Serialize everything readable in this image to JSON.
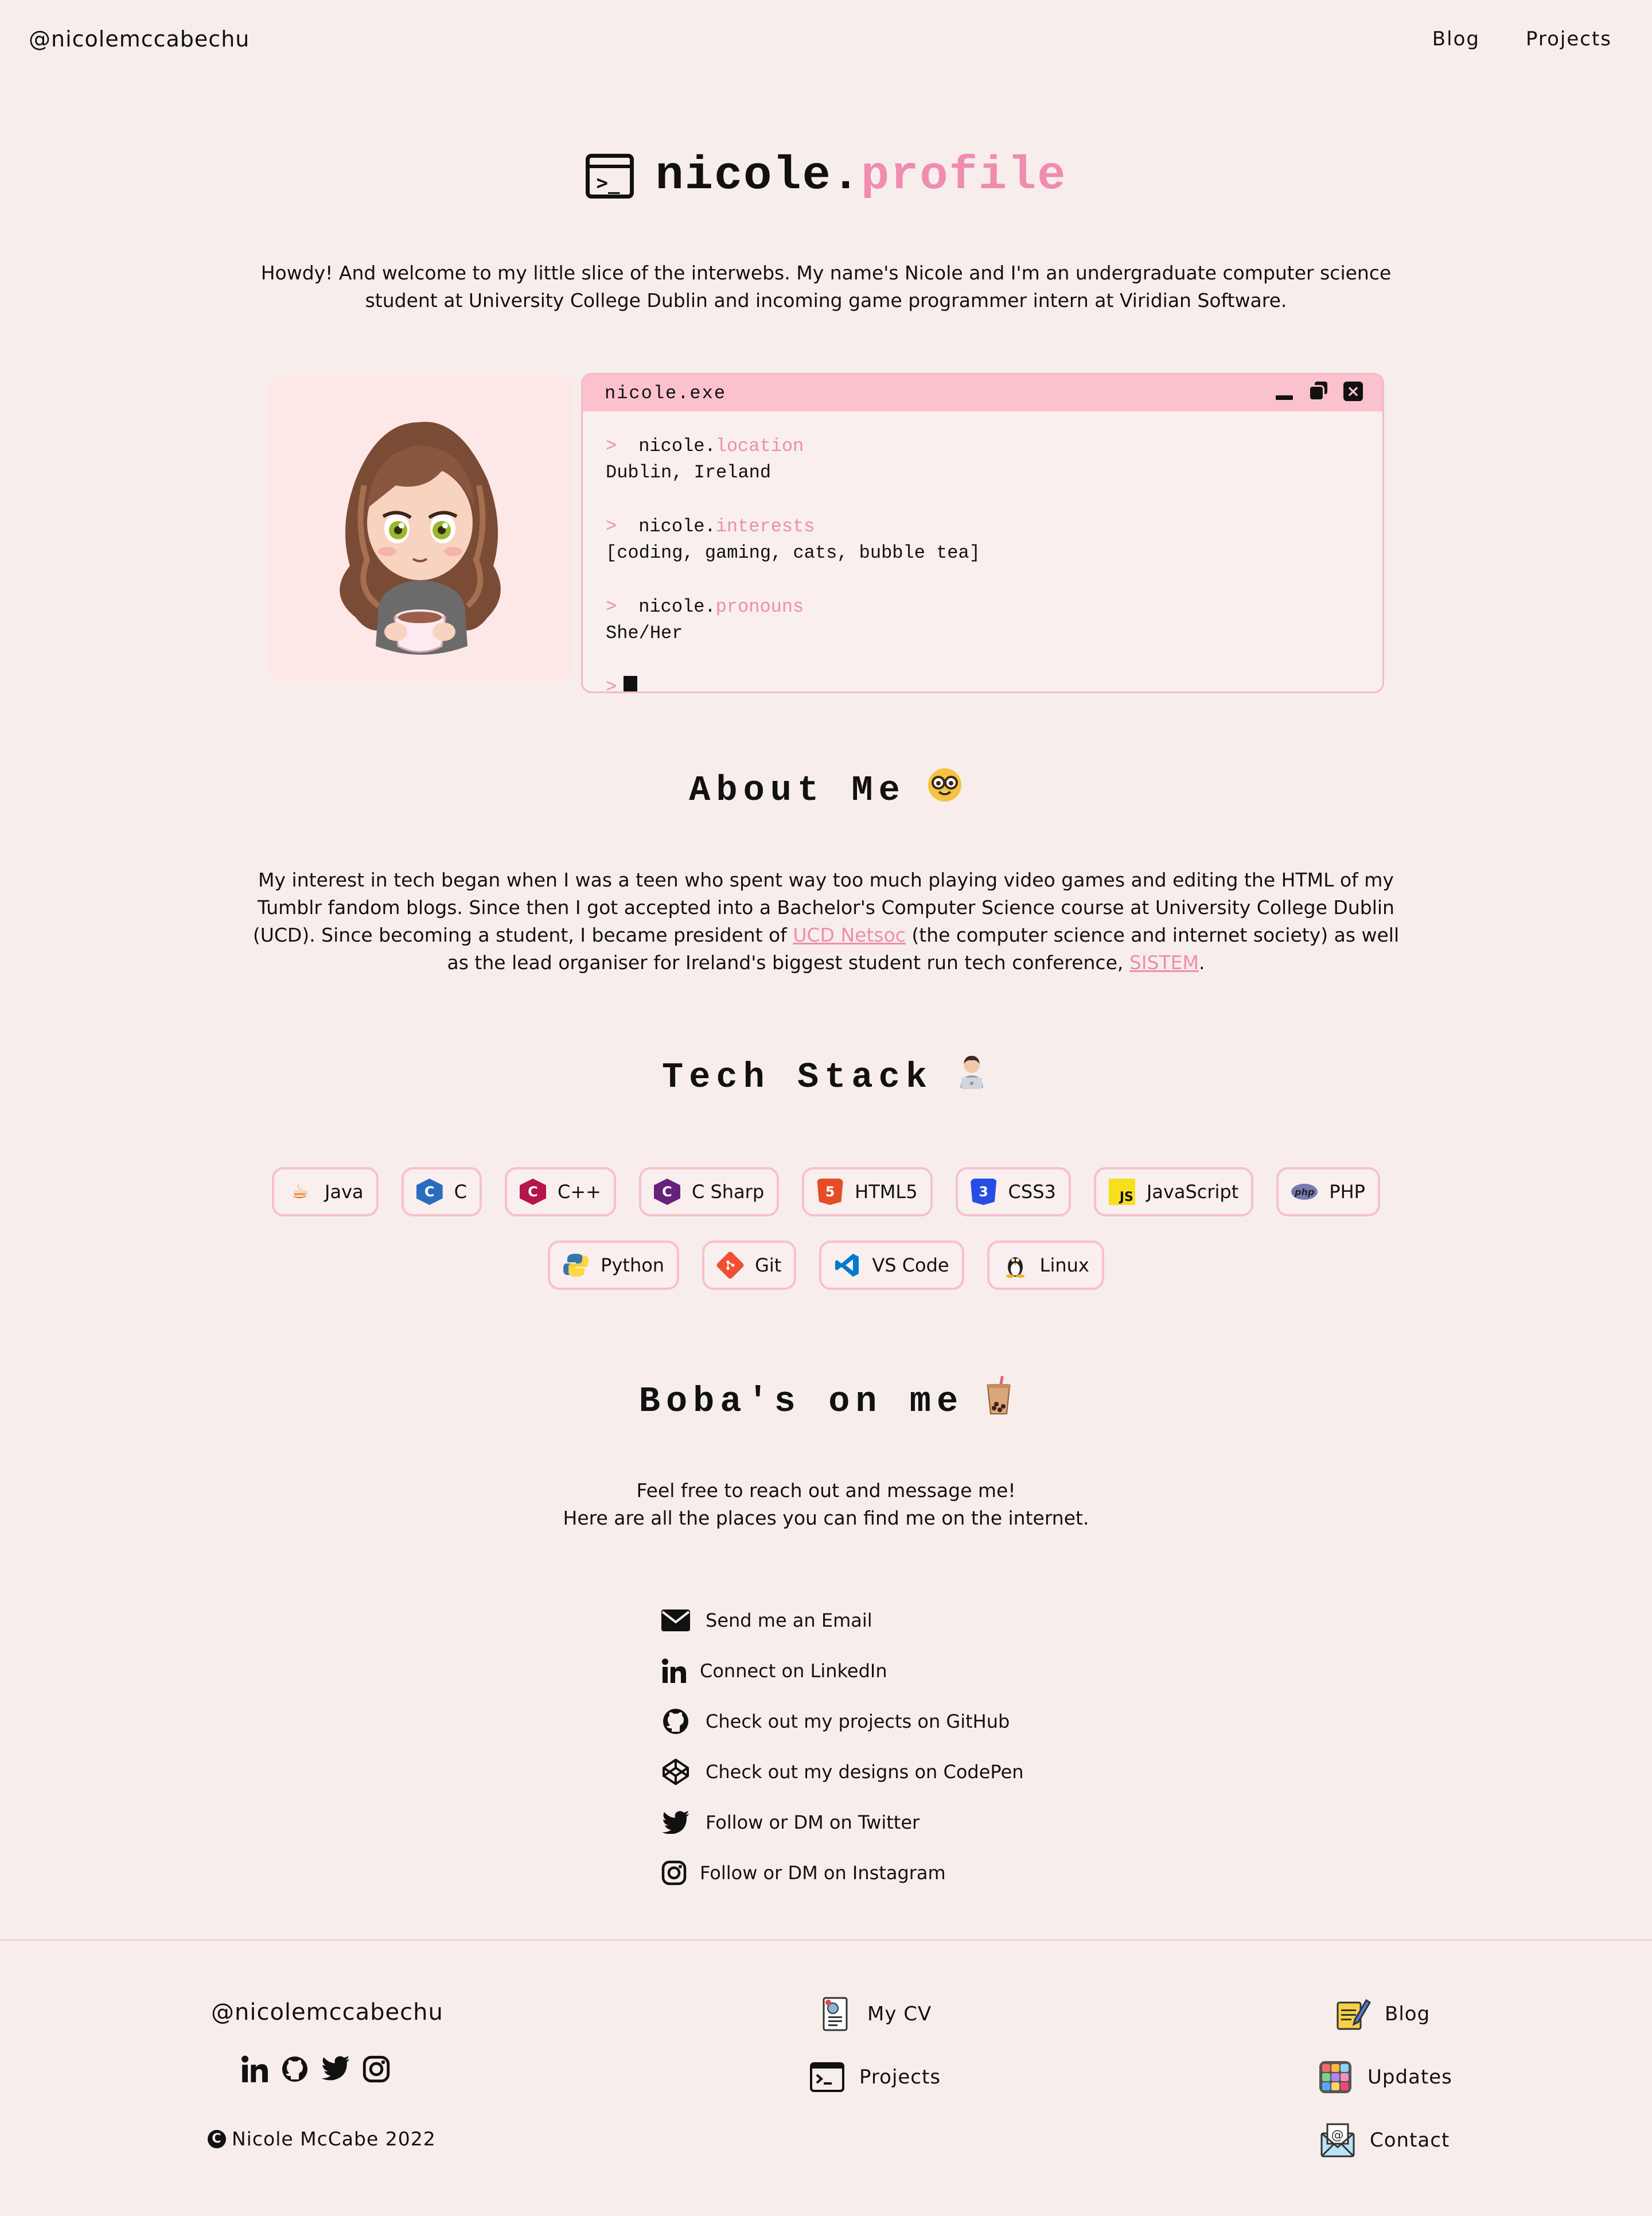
{
  "header": {
    "handle": "@nicolemccabechu",
    "nav": [
      {
        "label": "Blog"
      },
      {
        "label": "Projects"
      }
    ]
  },
  "hero": {
    "title_prefix": "nicole.",
    "title_suffix": "profile",
    "intro": "Howdy! And welcome to my little slice of the interwebs. My name's Nicole and I'm an undergraduate computer science student at University College Dublin and incoming game programmer intern at Viridian Software."
  },
  "terminal": {
    "title": "nicole.exe",
    "prompt": ">",
    "commands": [
      {
        "object": "nicole.",
        "property": "location",
        "output": "Dublin, Ireland"
      },
      {
        "object": "nicole.",
        "property": "interests",
        "output": "[coding, gaming, cats, bubble tea]"
      },
      {
        "object": "nicole.",
        "property": "pronouns",
        "output": "She/Her"
      }
    ]
  },
  "about": {
    "heading": "About Me",
    "text_1": "My interest in tech began when I was a teen who spent way too much playing video games and editing the HTML of my Tumblr fandom blogs. Since then I got accepted into a Bachelor's Computer Science course at University College Dublin (UCD). Since becoming a student, I became president of ",
    "link_1": "UCD Netsoc",
    "text_2": " (the computer science and internet society) as well as the lead organiser for Ireland's biggest student run tech conference, ",
    "link_2": "SISTEM",
    "text_3": "."
  },
  "tech": {
    "heading": "Tech Stack",
    "row1": [
      {
        "label": "Java",
        "icon": "java-icon",
        "color": "#e76f00"
      },
      {
        "label": "C",
        "icon": "c-icon",
        "color": "#2a6dbf"
      },
      {
        "label": "C++",
        "icon": "cpp-icon",
        "color": "#b5154b"
      },
      {
        "label": "C Sharp",
        "icon": "csharp-icon",
        "color": "#68217a"
      },
      {
        "label": "HTML5",
        "icon": "html5-icon",
        "color": "#e44d26"
      },
      {
        "label": "CSS3",
        "icon": "css3-icon",
        "color": "#264de4"
      },
      {
        "label": "JavaScript",
        "icon": "javascript-icon",
        "color": "#f7df1e"
      },
      {
        "label": "PHP",
        "icon": "php-icon",
        "color": "#777bb3"
      }
    ],
    "row2": [
      {
        "label": "Python",
        "icon": "python-icon",
        "color": "#3776ab"
      },
      {
        "label": "Git",
        "icon": "git-icon",
        "color": "#f05032"
      },
      {
        "label": "VS Code",
        "icon": "vscode-icon",
        "color": "#007acc"
      },
      {
        "label": "Linux",
        "icon": "linux-icon",
        "color": "#222222"
      }
    ]
  },
  "boba": {
    "heading": "Boba's on me",
    "line_1": "Feel free to reach out and message me!",
    "line_2": "Here are all the places you can find me on the internet."
  },
  "contacts": [
    {
      "label": "Send me an Email",
      "icon": "email-icon"
    },
    {
      "label": "Connect on LinkedIn",
      "icon": "linkedin-icon"
    },
    {
      "label": "Check out my projects on GitHub",
      "icon": "github-icon"
    },
    {
      "label": "Check out my designs on CodePen",
      "icon": "codepen-icon"
    },
    {
      "label": "Follow or DM on Twitter",
      "icon": "twitter-icon"
    },
    {
      "label": "Follow or DM on Instagram",
      "icon": "instagram-icon"
    }
  ],
  "footer": {
    "handle": "@nicolemccabechu",
    "copyright": "Nicole McCabe 2022",
    "links": [
      {
        "label": "My CV",
        "icon": "cv-icon"
      },
      {
        "label": "Projects",
        "icon": "terminal-icon"
      },
      {
        "label": "Blog",
        "icon": "notepad-pencil-icon"
      },
      {
        "label": "Updates",
        "icon": "grid-icon"
      },
      {
        "label": "Contact",
        "icon": "envelope-icon"
      }
    ]
  },
  "colors": {
    "background": "#f7eeec",
    "accent_pink": "#ef8cb0",
    "terminal_bar": "#fbc2cd",
    "chip_border": "#f8c0cc"
  }
}
